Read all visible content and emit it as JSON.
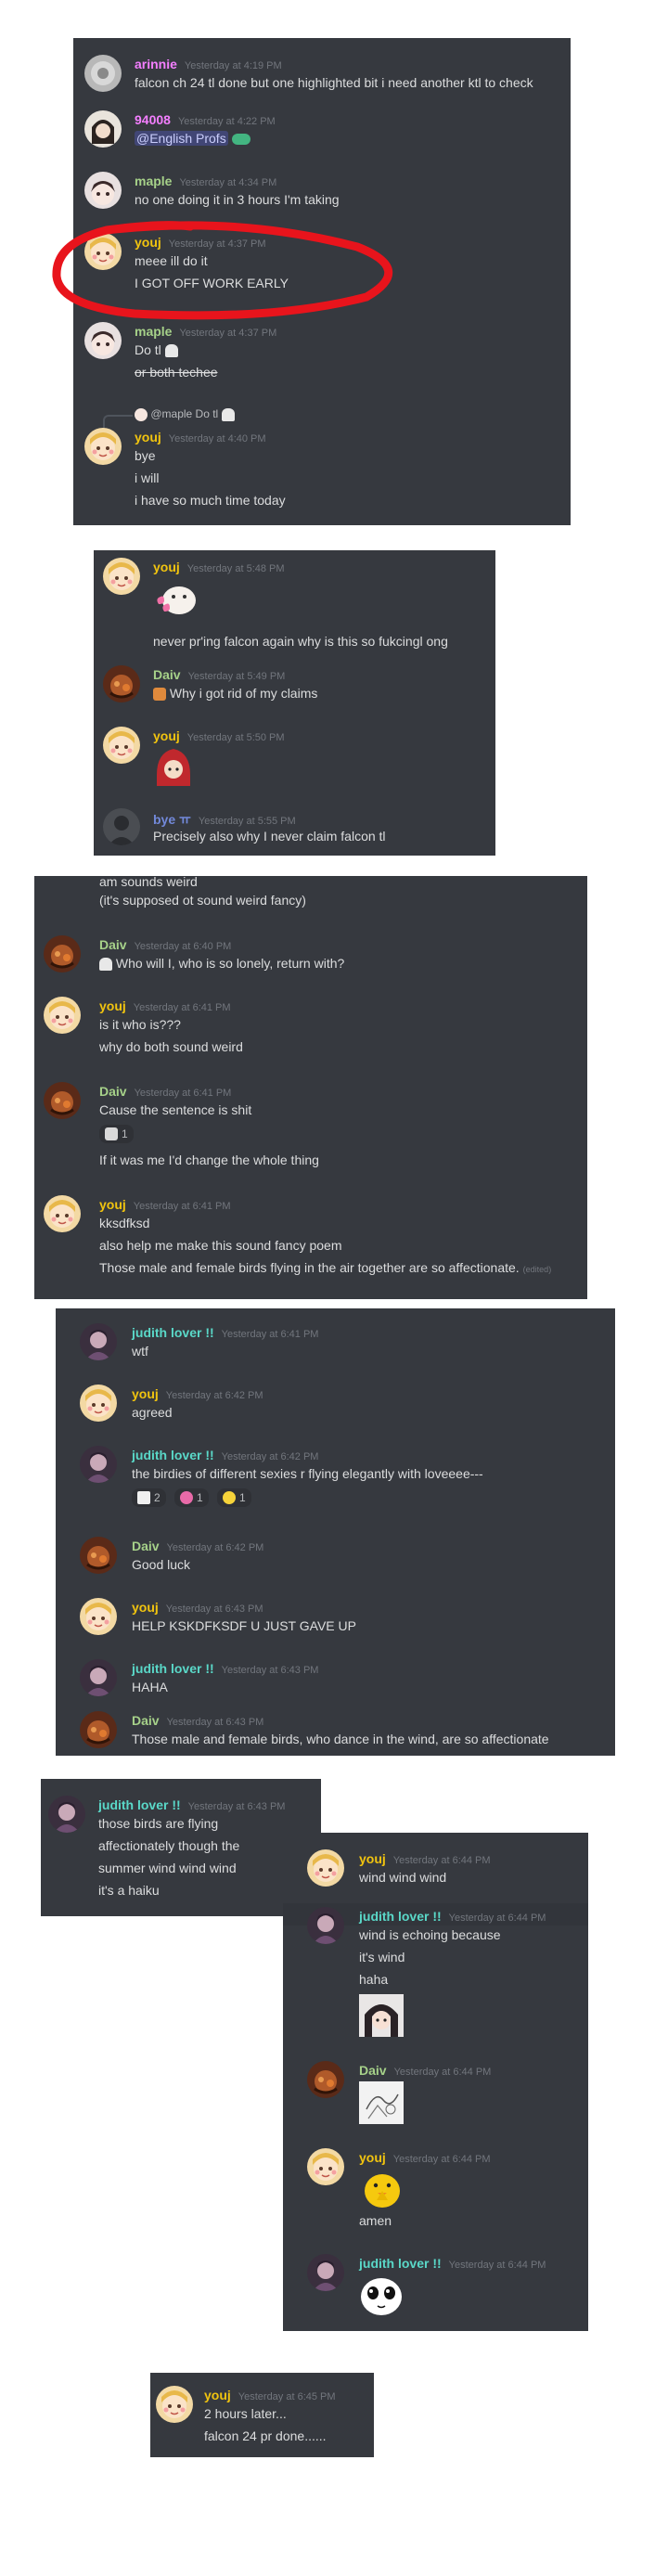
{
  "colors": {
    "panel": "#36393f",
    "pink": "#f47fff",
    "yellow": "#f1c40f",
    "green": "#a6d189",
    "teal": "#5ad8c8",
    "purple": "#b9a6ff",
    "blue": "#7289da",
    "annotation": "#e8141c"
  },
  "p1": {
    "m1": {
      "author": "arinnie",
      "ts": "Yesterday at 4:19 PM",
      "text": "falcon ch 24 tl done but one highlighted bit i need another ktl to check"
    },
    "m2": {
      "author": "94008",
      "ts": "Yesterday at 4:22 PM",
      "mention": "@English Profs"
    },
    "m3": {
      "author": "maple",
      "ts": "Yesterday at 4:34 PM",
      "text": "no one doing it in 3 hours I'm taking"
    },
    "m4": {
      "author": "youj",
      "ts": "Yesterday at 4:37 PM",
      "l1": "meee ill do it",
      "l2": "I GOT OFF WORK EARLY"
    },
    "m5": {
      "author": "maple",
      "ts": "Yesterday at 4:37 PM",
      "l1": "Do tl",
      "l2": "or both techee"
    },
    "m6": {
      "reply": "@maple Do tl",
      "author": "youj",
      "ts": "Yesterday at 4:40 PM",
      "l1": "bye",
      "l2": "i will",
      "l3": "i have so much time today"
    }
  },
  "p2": {
    "m1": {
      "author": "youj",
      "ts": "Yesterday at 5:48 PM",
      "text": "never pr'ing falcon again why is this so fukcingl ong"
    },
    "m2": {
      "author": "Daiv",
      "ts": "Yesterday at 5:49 PM",
      "text": "Why i got rid of my claims"
    },
    "m3": {
      "author": "youj",
      "ts": "Yesterday at 5:50 PM"
    },
    "m4": {
      "author": "bye ㅠ",
      "ts": "Yesterday at 5:55 PM",
      "text": "Precisely also why I never claim falcon tl"
    }
  },
  "p3": {
    "top1": "am sounds weird",
    "top2": "(it's supposed ot sound weird fancy)",
    "m1": {
      "author": "Daiv",
      "ts": "Yesterday at 6:40 PM",
      "text": "Who will I, who is so lonely, return with?"
    },
    "m2": {
      "author": "youj",
      "ts": "Yesterday at 6:41 PM",
      "l1": "is it who is???",
      "l2": "why do both sound weird"
    },
    "m3": {
      "author": "Daiv",
      "ts": "Yesterday at 6:41 PM",
      "l1": "Cause the sentence is shit",
      "reaction": "1",
      "l2": "If it was me I'd change the whole thing"
    },
    "m4": {
      "author": "youj",
      "ts": "Yesterday at 6:41 PM",
      "l1": "kksdfksd",
      "l2": "also help me make this sound fancy poem",
      "l3": "Those male and female birds flying in the air together are so affectionate.",
      "edited": "(edited)"
    }
  },
  "p4": {
    "m1": {
      "author": "judith lover !!",
      "ts": "Yesterday at 6:41 PM",
      "text": "wtf"
    },
    "m2": {
      "author": "youj",
      "ts": "Yesterday at 6:42 PM",
      "text": "agreed"
    },
    "m3": {
      "author": "judith lover !!",
      "ts": "Yesterday at 6:42 PM",
      "text": "the birdies of different sexies r flying elegantly with loveeee---",
      "r1": "2",
      "r2": "1",
      "r3": "1"
    },
    "m4": {
      "author": "Daiv",
      "ts": "Yesterday at 6:42 PM",
      "text": "Good luck"
    },
    "m5": {
      "author": "youj",
      "ts": "Yesterday at 6:43 PM",
      "text": "HELP KSKDFKSDF U JUST GAVE UP"
    },
    "m6": {
      "author": "judith lover !!",
      "ts": "Yesterday at 6:43 PM",
      "text": "HAHA"
    },
    "m7": {
      "author": "Daiv",
      "ts": "Yesterday at 6:43 PM",
      "text": "Those male and female birds, who dance in the wind, are so affectionate"
    }
  },
  "p5": {
    "m1": {
      "author": "judith lover !!",
      "ts": "Yesterday at 6:43 PM",
      "l1": "those birds are flying",
      "l2": "affectionately though the",
      "l3": "summer wind wind wind",
      "l4": "it's a haiku"
    }
  },
  "p6": {
    "m1": {
      "author": "youj",
      "ts": "Yesterday at 6:44 PM",
      "text": "wind wind wind"
    },
    "m2": {
      "author": "judith lover !!",
      "ts": "Yesterday at 6:44 PM",
      "l1": "wind is echoing because",
      "l2": "it's wind",
      "l3": "haha"
    },
    "m3": {
      "author": "Daiv",
      "ts": "Yesterday at 6:44 PM"
    },
    "m4": {
      "author": "youj",
      "ts": "Yesterday at 6:44 PM",
      "text": "amen"
    },
    "m5": {
      "author": "judith lover !!",
      "ts": "Yesterday at 6:44 PM"
    }
  },
  "p7": {
    "m1": {
      "author": "youj",
      "ts": "Yesterday at 6:45 PM",
      "l1": "2 hours later...",
      "l2": "falcon 24 pr done......"
    }
  }
}
